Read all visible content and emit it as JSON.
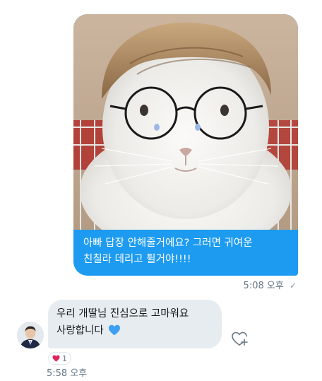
{
  "sent": {
    "text_line1": "아빠 답장 안해줄거에요? 그러면 귀여운",
    "text_line2": "친칠라 데리고 튈거야!!!!",
    "time": "5:08 오후",
    "status_icon": "sent-check-icon"
  },
  "received": {
    "text_line1": "우리 개딸님 진심으로 고마워요",
    "text_line2": "사랑합니다",
    "inline_emoji": "blue-heart-icon",
    "reaction": {
      "icon": "red-heart-icon",
      "count": "1"
    },
    "time": "5:58 오후"
  },
  "colors": {
    "sent_bubble": "#1d9bf0",
    "received_bubble": "#e7ecf0",
    "meta_text": "#657786",
    "heart_red": "#e0245e",
    "heart_blue": "#3ea0f2"
  }
}
